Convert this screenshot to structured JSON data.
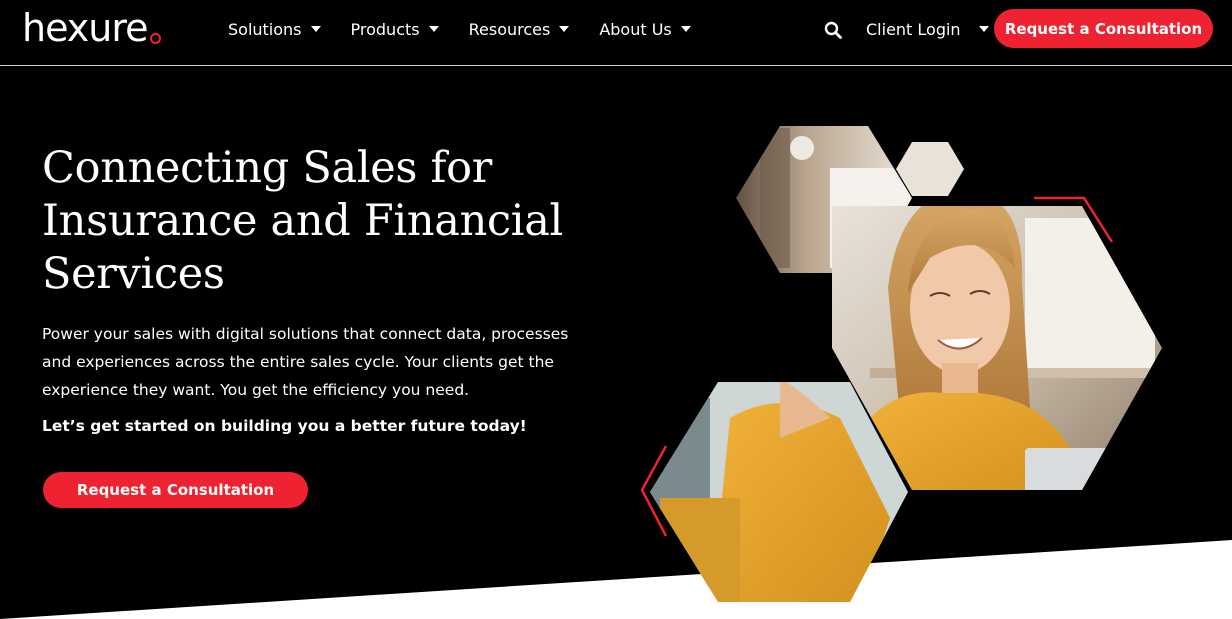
{
  "header": {
    "logo_text": "hexure",
    "nav": [
      {
        "label": "Solutions"
      },
      {
        "label": "Products"
      },
      {
        "label": "Resources"
      },
      {
        "label": "About Us"
      }
    ],
    "client_login": "Client Login",
    "cta_label": "Request a Consultation"
  },
  "hero": {
    "title": "Connecting Sales for Insurance and Financial Services",
    "description": "Power your sales with digital solutions that connect data, processes and experiences across the entire sales cycle. Your clients get the experience they want. You get the efficiency you need.",
    "tagline": "Let’s get started on building you a better future today!",
    "cta_label": "Request a Consultation"
  },
  "colors": {
    "accent": "#ee2230",
    "background": "#000000",
    "text": "#ffffff"
  },
  "icons": {
    "search": "search-icon",
    "caret": "caret-down-icon",
    "logo_mark": "circle-dot-icon"
  }
}
